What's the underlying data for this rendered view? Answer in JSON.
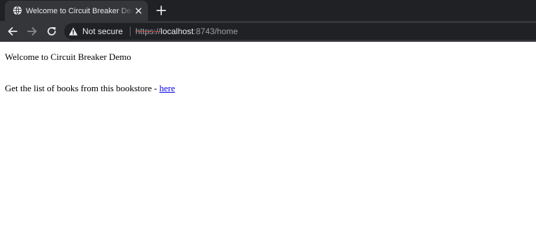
{
  "browser": {
    "tab": {
      "title": "Welcome to Circuit Breaker Demo",
      "favicon": "globe-icon",
      "close_icon": "close-icon"
    },
    "new_tab_icon": "plus-icon",
    "toolbar": {
      "back_icon": "back-arrow-icon",
      "forward_icon": "forward-arrow-icon",
      "reload_icon": "reload-icon"
    },
    "address_bar": {
      "security_icon": "warning-icon",
      "security_label": "Not secure",
      "url_scheme": "https://",
      "url_host": "localhost",
      "url_rest": ":8743/home"
    },
    "colors": {
      "tabstrip_bg": "#202124",
      "toolbar_bg": "#35363a",
      "omnibox_bg": "#202124",
      "link": "#0000ee"
    }
  },
  "page": {
    "heading": "Welcome to Circuit Breaker Demo",
    "books_text": "Get the list of books from this bookstore - ",
    "books_link": "here"
  }
}
